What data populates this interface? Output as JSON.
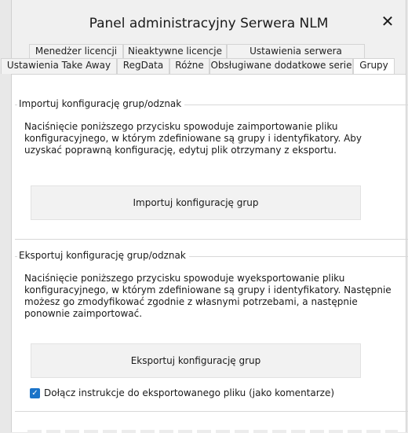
{
  "window": {
    "title": "Panel administracyjny Serwera NLM",
    "close_glyph": "✕"
  },
  "tabs_row1": [
    {
      "label": "Menedżer licencji"
    },
    {
      "label": "Nieaktywne licencje"
    },
    {
      "label": "Ustawienia serwera"
    }
  ],
  "tabs_row2": [
    {
      "label": "Ustawienia Take Away"
    },
    {
      "label": "RegData"
    },
    {
      "label": "Różne"
    },
    {
      "label": "Obsługiwane dodatkowe serie"
    },
    {
      "label": "Grupy",
      "active": true
    }
  ],
  "import_group": {
    "legend": "Importuj konfigurację grup/odznak",
    "description": "Naciśnięcie poniższego przycisku spowoduje zaimportowanie pliku konfiguracyjnego, w którym zdefiniowane są grupy i identyfikatory. Aby uzyskać poprawną konfigurację, edytuj plik otrzymany z eksportu.",
    "button": "Importuj konfigurację grup"
  },
  "export_group": {
    "legend": "Eksportuj konfigurację grup/odznak",
    "description": "Naciśnięcie poniższego przycisku spowoduje wyeksportowanie pliku konfiguracyjnego, w którym zdefiniowane są grupy i identyfikatory. Następnie możesz go zmodyfikować zgodnie z własnymi potrzebami, a następnie ponownie zaimportować.",
    "button": "Eksportuj konfigurację grup",
    "checkbox_label": "Dołącz instrukcje do eksportowanego pliku (jako komentarze)",
    "checkbox_checked": true,
    "checkbox_glyph": "✓"
  },
  "colors": {
    "accent": "#1a73c8"
  }
}
